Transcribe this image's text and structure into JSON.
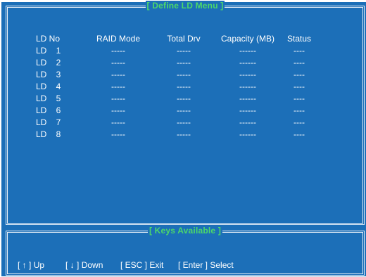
{
  "main_panel": {
    "title": "[  Define LD Menu  ]",
    "headers": {
      "ld_no": "LD No",
      "raid_mode": "RAID Mode",
      "total_drv": "Total Drv",
      "capacity": "Capacity (MB)",
      "status": "Status"
    },
    "rows": [
      {
        "ld": "LD",
        "num": "1",
        "raid_mode": "-----",
        "total_drv": "-----",
        "capacity": "------",
        "status": "----"
      },
      {
        "ld": "LD",
        "num": "2",
        "raid_mode": "-----",
        "total_drv": "-----",
        "capacity": "------",
        "status": "----"
      },
      {
        "ld": "LD",
        "num": "3",
        "raid_mode": "-----",
        "total_drv": "-----",
        "capacity": "------",
        "status": "----"
      },
      {
        "ld": "LD",
        "num": "4",
        "raid_mode": "-----",
        "total_drv": "-----",
        "capacity": "------",
        "status": "----"
      },
      {
        "ld": "LD",
        "num": "5",
        "raid_mode": "-----",
        "total_drv": "-----",
        "capacity": "------",
        "status": "----"
      },
      {
        "ld": "LD",
        "num": "6",
        "raid_mode": "-----",
        "total_drv": "-----",
        "capacity": "------",
        "status": "----"
      },
      {
        "ld": "LD",
        "num": "7",
        "raid_mode": "-----",
        "total_drv": "-----",
        "capacity": "------",
        "status": "----"
      },
      {
        "ld": "LD",
        "num": "8",
        "raid_mode": "-----",
        "total_drv": "-----",
        "capacity": "------",
        "status": "----"
      }
    ]
  },
  "keys_panel": {
    "title": "[  Keys Available  ]",
    "keys": [
      {
        "key": "[ ↑ ]",
        "label": "Up",
        "icon": "arrow-up-icon"
      },
      {
        "key": "[ ↓ ]",
        "label": "Down",
        "icon": "arrow-down-icon"
      },
      {
        "key": "[ ESC ]",
        "label": "Exit"
      },
      {
        "key": "[ Enter ]",
        "label": "Select"
      }
    ]
  },
  "colors": {
    "background": "#1c6fb8",
    "text": "#ffffff",
    "title_accent": "#4cd86a",
    "border": "#e8f0f8"
  }
}
